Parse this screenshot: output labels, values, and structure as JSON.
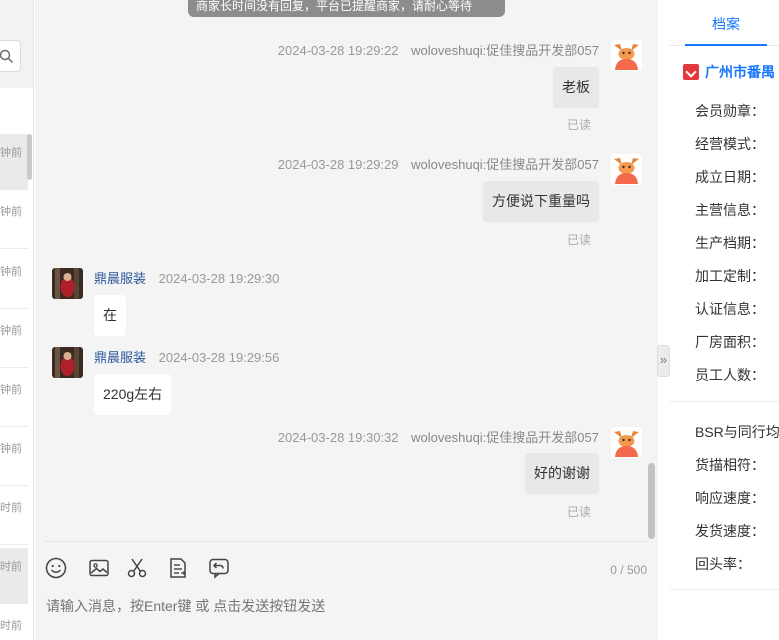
{
  "session_list": {
    "items": [
      {
        "time": "钟前",
        "active": true
      },
      {
        "time": "钟前",
        "active": false
      },
      {
        "time": "钟前",
        "active": false
      },
      {
        "time": "钟前",
        "active": false
      },
      {
        "time": "钟前",
        "active": false
      },
      {
        "time": "钟前",
        "active": false
      },
      {
        "time": "时前",
        "active": false
      },
      {
        "time": "时前",
        "active": true
      },
      {
        "time": "时前",
        "active": false
      }
    ]
  },
  "chat": {
    "top_notice": "商家长时间没有回复，平台已提醒商家，请耐心等待",
    "messages": [
      {
        "side": "me",
        "time": "2024-03-28 19:29:22",
        "sender": "woloveshuqi:促佳搜品开发部057",
        "text": "老板",
        "status": "已读"
      },
      {
        "side": "me",
        "time": "2024-03-28 19:29:29",
        "sender": "woloveshuqi:促佳搜品开发部057",
        "text": "方便说下重量吗",
        "status": "已读"
      },
      {
        "side": "other",
        "time": "2024-03-28 19:29:30",
        "sender": "鼎晨服装",
        "text": "在"
      },
      {
        "side": "other",
        "time": "2024-03-28 19:29:56",
        "sender": "鼎晨服装",
        "text": "220g左右"
      },
      {
        "side": "me",
        "time": "2024-03-28 19:30:32",
        "sender": "woloveshuqi:促佳搜品开发部057",
        "text": "好的谢谢",
        "status": "已读"
      }
    ],
    "toolbar": {
      "icons": [
        "emoji-icon",
        "image-icon",
        "scissors-icon",
        "document-icon",
        "reply-icon"
      ],
      "counter": "0 / 500"
    },
    "input": {
      "value": "",
      "placeholder": "请输入消息，按Enter键 或 点击发送按钮发送"
    }
  },
  "right_panel": {
    "tab": "档案",
    "company": "广州市番禺",
    "info_labels": [
      "会员勋章：",
      "经营模式：",
      "成立日期：",
      "主营信息：",
      "生产档期：",
      "加工定制：",
      "认证信息：",
      "厂房面积：",
      "员工人数："
    ],
    "service_labels": [
      "BSR与同行均",
      "货描相符：",
      "响应速度：",
      "发货速度：",
      "回头率："
    ]
  },
  "colors": {
    "accent": "#1677ff",
    "bubble_me": "#e8e8e8",
    "bubble_other": "#ffffff",
    "chat_bg": "#f4f4f4",
    "brand_red": "#e4393c"
  }
}
